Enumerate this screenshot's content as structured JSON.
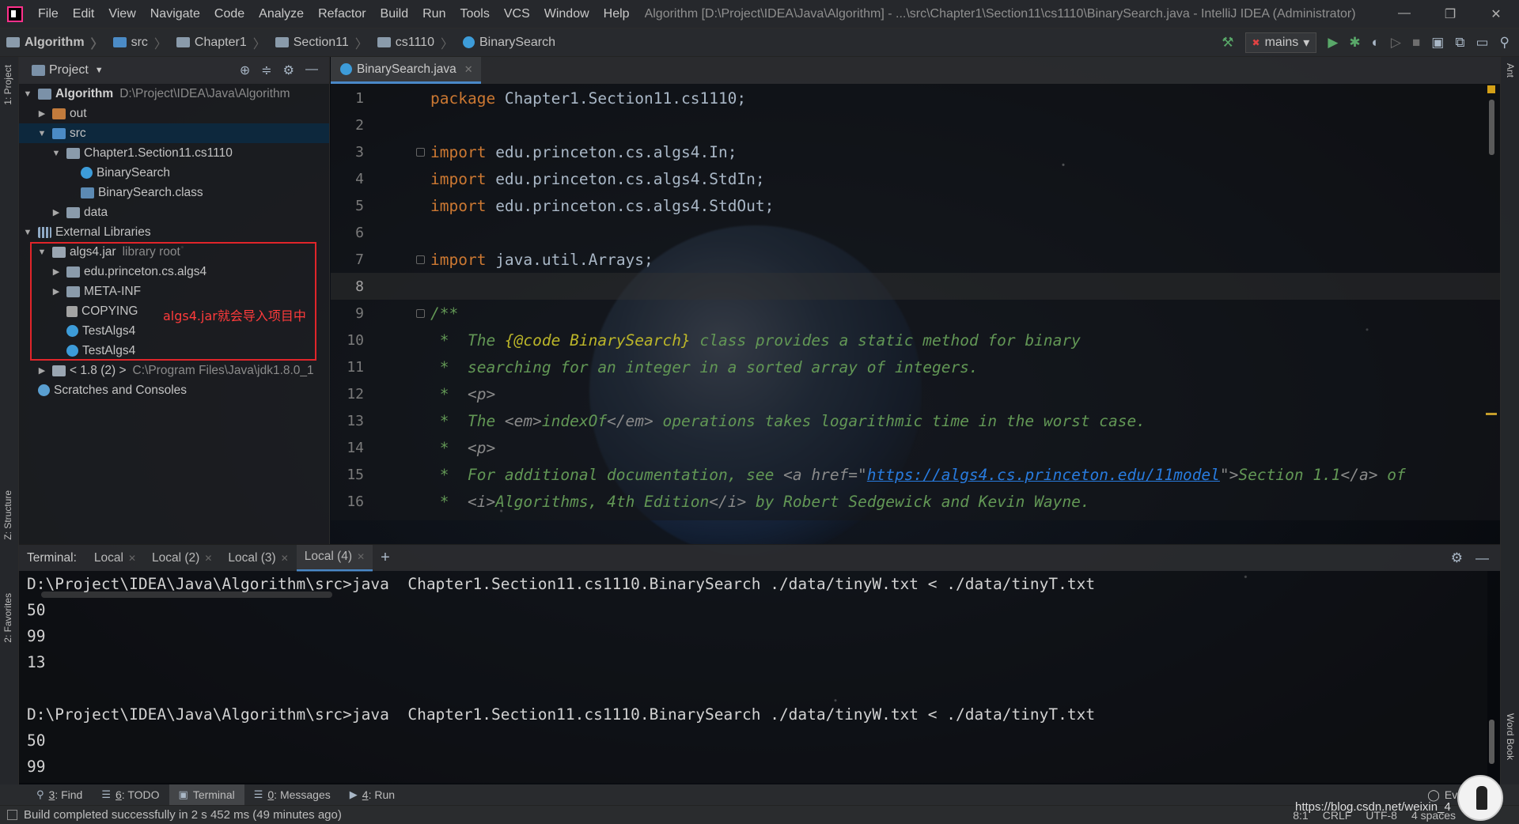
{
  "menubar": {
    "items": [
      "File",
      "Edit",
      "View",
      "Navigate",
      "Code",
      "Analyze",
      "Refactor",
      "Build",
      "Run",
      "Tools",
      "VCS",
      "Window",
      "Help"
    ],
    "title": "Algorithm [D:\\Project\\IDEA\\Java\\Algorithm] - ...\\src\\Chapter1\\Section11\\cs1110\\BinarySearch.java - IntelliJ IDEA (Administrator)",
    "minimize": "—",
    "restore": "❐",
    "close": "✕"
  },
  "navbar": {
    "crumbs": [
      "Algorithm",
      "src",
      "Chapter1",
      "Section11",
      "cs1110",
      "BinarySearch"
    ],
    "run_config": "mains"
  },
  "left_stripe": {
    "project": "1: Project",
    "structure": "Z: Structure",
    "favorites": "2: Favorites"
  },
  "right_stripe": {
    "ant": "Ant",
    "wordbook": "Word Book"
  },
  "project_panel": {
    "title": "Project",
    "tree": [
      {
        "label": "Algorithm",
        "extra": "D:\\Project\\IDEA\\Java\\Algorithm"
      },
      {
        "label": "out"
      },
      {
        "label": "src"
      },
      {
        "label": "Chapter1.Section11.cs1110"
      },
      {
        "label": "BinarySearch"
      },
      {
        "label": "BinarySearch.class"
      },
      {
        "label": "data"
      },
      {
        "label": "External Libraries"
      },
      {
        "label": "algs4.jar",
        "extra": "library root"
      },
      {
        "label": "edu.princeton.cs.algs4"
      },
      {
        "label": "META-INF"
      },
      {
        "label": "COPYING"
      },
      {
        "label": "TestAlgs4"
      },
      {
        "label": "TestAlgs4"
      },
      {
        "label": "< 1.8 (2) >",
        "extra": "C:\\Program Files\\Java\\jdk1.8.0_1"
      },
      {
        "label": "Scratches and Consoles"
      }
    ],
    "annotation": "algs4.jar就会导入项目中"
  },
  "editor": {
    "tab": "BinarySearch.java",
    "line_numbers": [
      "1",
      "2",
      "3",
      "4",
      "5",
      "6",
      "7",
      "8",
      "9",
      "10",
      "11",
      "12",
      "13",
      "14",
      "15",
      "16"
    ],
    "code": {
      "l1_kw": "package",
      "l1_rest": " Chapter1.Section11.cs1110;",
      "l3_kw": "import",
      "l3_rest": " edu.princeton.cs.algs4.In;",
      "l4_kw": "import",
      "l4_rest": " edu.princeton.cs.algs4.StdIn;",
      "l5_kw": "import",
      "l5_rest": " edu.princeton.cs.algs4.StdOut;",
      "l7_kw": "import",
      "l7_rest": " java.util.Arrays;",
      "l9": "/**",
      "l10_a": " *  The ",
      "l10_ann": "{@code",
      "l10_b": " BinarySearch}",
      "l10_c": " class provides a static method for binary",
      "l11": " *  searching for an integer in a sorted array of integers.",
      "l12_a": " *  ",
      "l12_tag": "<p>",
      "l13_a": " *  The ",
      "l13_tag1": "<em>",
      "l13_b": "indexOf",
      "l13_tag2": "</em>",
      "l13_c": " operations takes logarithmic time in the worst case.",
      "l14_a": " *  ",
      "l14_tag": "<p>",
      "l15_a": " *  For additional documentation, see ",
      "l15_tag1": "<a href=\"",
      "l15_link": "https://algs4.cs.princeton.edu/11model",
      "l15_tag2": "\">",
      "l15_b": "Section 1.1",
      "l15_tag3": "</a>",
      "l15_c": " of",
      "l16_a": " *  ",
      "l16_tag1": "<i>",
      "l16_b": "Algorithms, 4th Edition",
      "l16_tag2": "</i>",
      "l16_c": " by Robert Sedgewick and Kevin Wayne."
    }
  },
  "terminal": {
    "title": "Terminal:",
    "tabs": [
      "Local",
      "Local (2)",
      "Local (3)",
      "Local (4)"
    ],
    "add": "+",
    "lines": [
      "D:\\Project\\IDEA\\Java\\Algorithm\\src>java  Chapter1.Section11.cs1110.BinarySearch ./data/tinyW.txt < ./data/tinyT.txt",
      "50",
      "99",
      "13",
      "",
      "D:\\Project\\IDEA\\Java\\Algorithm\\src>java  Chapter1.Section11.cs1110.BinarySearch ./data/tinyW.txt < ./data/tinyT.txt",
      "50",
      "99"
    ]
  },
  "toolwindows": {
    "find_num": "3",
    "find": ": Find",
    "todo_num": "6",
    "todo": ": TODO",
    "terminal": "Terminal",
    "messages_num": "0",
    "messages": ": Messages",
    "run_num": "4",
    "run": ": Run",
    "event_log": "Eve"
  },
  "statusbar": {
    "message": "Build completed successfully in 2 s 452 ms (49 minutes ago)",
    "position": "8:1",
    "line_sep": "CRLF",
    "encoding": "UTF-8",
    "indent": "4 spaces"
  },
  "watermark": "https://blog.csdn.net/weixin_4"
}
